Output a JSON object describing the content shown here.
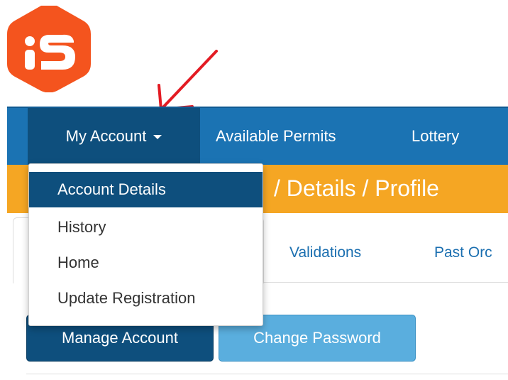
{
  "nav": {
    "my_account": "My Account",
    "available_permits": "Available Permits",
    "lottery": "Lottery"
  },
  "breadcrumb": {
    "text": "/ Details / Profile"
  },
  "dropdown": {
    "items": [
      {
        "label": "Account Details"
      },
      {
        "label": "History"
      },
      {
        "label": "Home"
      },
      {
        "label": "Update Registration"
      }
    ]
  },
  "tabs": {
    "validations": "Validations",
    "past_orders": "Past Orc"
  },
  "buttons": {
    "manage_account": "Manage Account",
    "change_password": "Change Password"
  },
  "icons": {
    "logo": "is-logo-icon",
    "annotation": "red-arrow-icon",
    "caret": "caret-down-icon"
  },
  "colors": {
    "navbar": "#1b73b3",
    "navbar_active": "#0e4f7d",
    "breadcrumb": "#f5a623",
    "logo": "#f4541e",
    "arrow": "#e31b23",
    "btn_primary": "#0e4f7d",
    "btn_secondary": "#5aaede",
    "link": "#1b6fb0"
  }
}
